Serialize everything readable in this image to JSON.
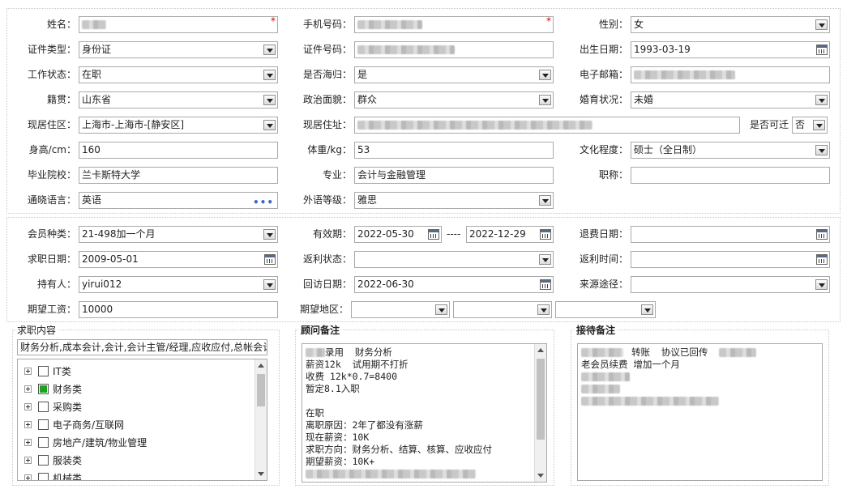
{
  "basic": {
    "name_label": "姓名：",
    "phone_label": "手机号码：",
    "gender_label": "性别：",
    "gender_value": "女",
    "id_type_label": "证件类型：",
    "id_type_value": "身份证",
    "id_no_label": "证件号码：",
    "birth_label": "出生日期：",
    "birth_value": "1993-03-19",
    "work_status_label": "工作状态：",
    "work_status_value": "在职",
    "returnee_label": "是否海归：",
    "returnee_value": "是",
    "email_label": "电子邮箱：",
    "native_label": "籍贯：",
    "native_value": "山东省",
    "politics_label": "政治面貌：",
    "politics_value": "群众",
    "marital_label": "婚育状况：",
    "marital_value": "未婚",
    "region_label": "现居住区：",
    "region_value": "上海市-上海市-[静安区]",
    "address_label": "现居住址：",
    "relocate_label": "是否可迁",
    "relocate_value": "否",
    "height_label": "身高/cm：",
    "height_value": "160",
    "weight_label": "体重/kg：",
    "weight_value": "53",
    "education_label": "文化程度：",
    "education_value": "硕士（全日制）",
    "school_label": "毕业院校：",
    "school_value": "兰卡斯特大学",
    "major_label": "专业：",
    "major_value": "会计与金融管理",
    "title_label": "职称：",
    "title_value": "",
    "language_label": "通晓语言：",
    "language_value": "英语",
    "lang_level_label": "外语等级：",
    "lang_level_value": "雅思",
    "required_mark": "*"
  },
  "member": {
    "type_label": "会员种类：",
    "type_value": "21-498加一个月",
    "valid_label": "有效期：",
    "valid_from": "2022-05-30",
    "valid_sep": "----",
    "valid_to": "2022-12-29",
    "refund_label": "退费日期：",
    "job_date_label": "求职日期：",
    "job_date_value": "2009-05-01",
    "rebate_status_label": "返利状态：",
    "rebate_time_label": "返利时间：",
    "holder_label": "持有人：",
    "holder_value": "yirui012",
    "visit_label": "回访日期：",
    "visit_value": "2022-06-30",
    "source_label": "来源途径：",
    "salary_label": "期望工资：",
    "salary_value": "10000",
    "area_label": "期望地区："
  },
  "job_content": {
    "title": "求职内容",
    "summary": "财务分析,成本会计,会计,会计主管/经理,应收应付,总帐会计",
    "categories": [
      {
        "label": "IT类",
        "checked": false
      },
      {
        "label": "财务类",
        "checked": true
      },
      {
        "label": "采购类",
        "checked": false
      },
      {
        "label": "电子商务/互联网",
        "checked": false
      },
      {
        "label": "房地产/建筑/物业管理",
        "checked": false
      },
      {
        "label": "服装类",
        "checked": false
      },
      {
        "label": "机械类",
        "checked": false
      }
    ]
  },
  "advisor": {
    "title": "顾问备注",
    "lines": [
      "录用  财务分析",
      "薪资12k  试用期不打折",
      "收费 12k*0.7=8400",
      "暂定8.1入职",
      "",
      "在职",
      "离职原因：2年了都没有涨薪",
      "现在薪资：10K",
      "求职方向：财务分析、结算、核算、应收应付",
      "期望薪资：10K+"
    ]
  },
  "reception": {
    "title": "接待备注",
    "lines": [
      "转账  协议已回传",
      "老会员续费 增加一个月"
    ]
  }
}
